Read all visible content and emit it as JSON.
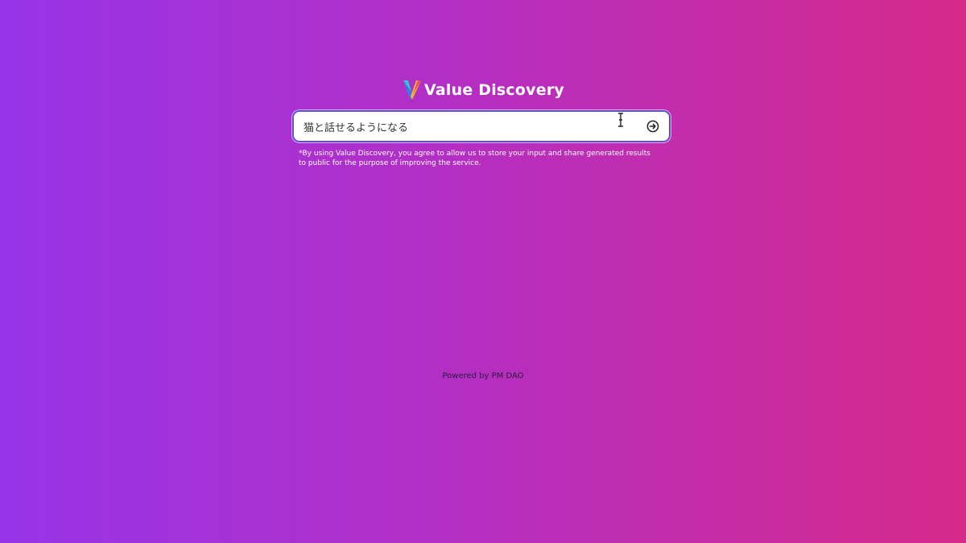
{
  "brand": {
    "name": "Value Discovery",
    "logo_icon": "v-logo-icon",
    "logo_colors": [
      "#f2b233",
      "#e94b6a",
      "#3a7be0",
      "#3cc1d8"
    ]
  },
  "search": {
    "value": "猫と話せるようになる",
    "placeholder": "",
    "submit_icon": "arrow-right-circle-icon",
    "border_color": "#5a4fd8"
  },
  "disclaimer": {
    "text": "*By using Value Discovery, you agree to allow us to store your input and share generated results to public for the purpose of improving the service."
  },
  "footer": {
    "text": "Powered by PM DAO"
  },
  "colors": {
    "gradient_start": "#9734e8",
    "gradient_end": "#d62a8a"
  }
}
